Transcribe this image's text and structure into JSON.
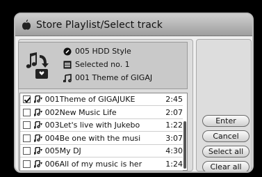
{
  "dialog": {
    "title": "Store Playlist/Select track",
    "title_icon": "apple-icon"
  },
  "info": {
    "playlist": "005  HDD Style",
    "selected": "Selected no. 1",
    "current": "001  Theme of GIGAJ",
    "icons": [
      "disc-icon",
      "list-icon",
      "music-note-icon"
    ]
  },
  "tracks": [
    {
      "num": "001",
      "name": "Theme of GIGAJUKE",
      "duration": "2:45",
      "checked": true
    },
    {
      "num": "002",
      "name": "New Music Life",
      "duration": "2:07",
      "checked": false
    },
    {
      "num": "003",
      "name": "Let's live with Jukebo",
      "duration": "1:22",
      "checked": false
    },
    {
      "num": "004",
      "name": "Be one with the musi",
      "duration": "3:07",
      "checked": false
    },
    {
      "num": "005",
      "name": "My DJ",
      "duration": "4:30",
      "checked": false
    },
    {
      "num": "006",
      "name": "All of my music is her",
      "duration": "1:24",
      "checked": false
    }
  ],
  "buttons": {
    "enter": "Enter",
    "cancel": "Cancel",
    "select_all": "Select all",
    "clear_all": "Clear all"
  }
}
